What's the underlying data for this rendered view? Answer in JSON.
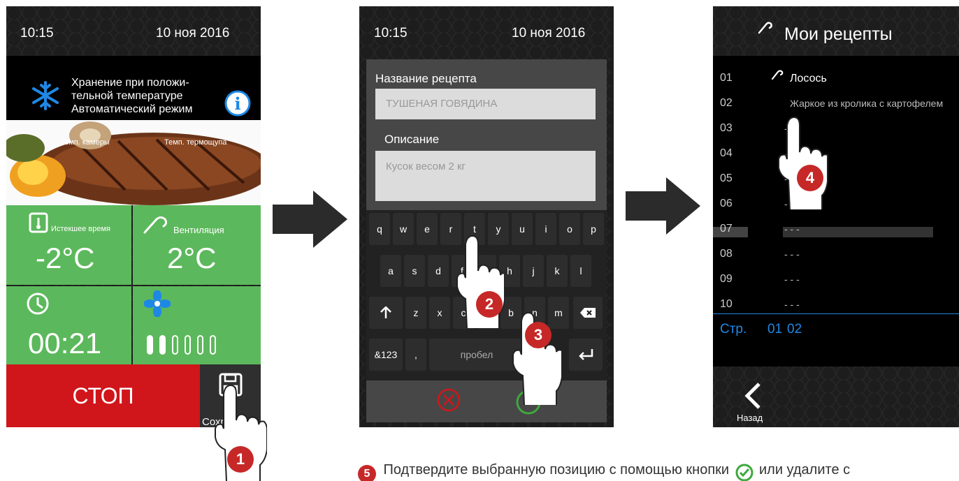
{
  "screen1": {
    "time": "10:15",
    "date": "10 ноя 2016",
    "mode_line1": "Хранение при положи-",
    "mode_line2": "тельной температуре",
    "mode_line3": "Автоматический режим",
    "label_chamber": "Темп. камеры",
    "label_probe": "Темп. термощупа",
    "tile1_label": "Истекшее время",
    "tile1_value": "-2°C",
    "tile2_label": "Вентиляция",
    "tile2_value": "2°C",
    "tile3_value": "00:21",
    "stop_label": "СТОП",
    "save_label": "Сохранить",
    "fan_level": 2,
    "fan_max": 6
  },
  "screen2": {
    "time": "10:15",
    "date": "10 ноя 2016",
    "name_label": "Название рецепта",
    "name_value": "ТУШЕНАЯ ГОВЯДИНА",
    "desc_label": "Описание",
    "desc_value": "Кусок весом 2 кг",
    "row1": [
      "q",
      "w",
      "e",
      "r",
      "t",
      "y",
      "u",
      "i",
      "o",
      "p"
    ],
    "row2": [
      "a",
      "s",
      "d",
      "f",
      "g",
      "h",
      "j",
      "k",
      "l"
    ],
    "row3": [
      "z",
      "x",
      "c",
      "v",
      "b",
      "n",
      "m"
    ],
    "key_numbers": "&123",
    "key_comma": ",",
    "key_space": "пробел"
  },
  "screen3": {
    "title": "Мои рецепты",
    "numbers": [
      "01",
      "02",
      "03",
      "04",
      "05",
      "06",
      "07",
      "08",
      "09",
      "10"
    ],
    "recipe1": "Лосось",
    "recipe2": "Жаркое из кролика с картофелем",
    "empty": "- - -",
    "page_label": "Стр.",
    "page1": "01",
    "page2": "02",
    "back_label": "Назад"
  },
  "steps": {
    "s1": "1",
    "s2": "2",
    "s3": "3",
    "s4": "4",
    "s5": "5"
  },
  "caption": "Подтвердите выбранную позицию с помощью кнопки",
  "caption_tail": "или удалите с",
  "colors": {
    "green": "#5cb85c",
    "red": "#d0161b",
    "blue": "#1e88e5",
    "badge": "#c62828"
  }
}
